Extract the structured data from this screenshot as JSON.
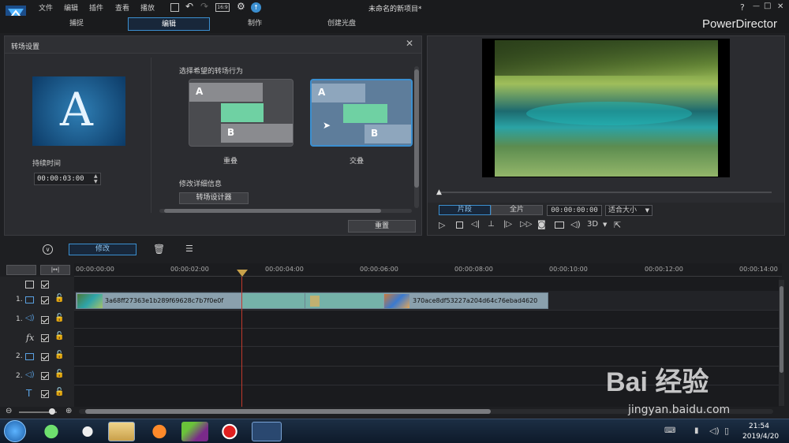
{
  "app": {
    "name": "PowerDirector",
    "project_title": "未命名的新项目*",
    "menus": [
      "文件",
      "编辑",
      "插件",
      "查看",
      "播放"
    ],
    "window_controls": [
      "?",
      "—",
      "□",
      "✕"
    ]
  },
  "mode_tabs": [
    {
      "label": "捕捉",
      "active": false
    },
    {
      "label": "编辑",
      "active": true
    },
    {
      "label": "制作",
      "active": false
    },
    {
      "label": "创建光盘",
      "active": false
    }
  ],
  "transition_panel": {
    "title": "转场设置",
    "thumb_letter": "A",
    "duration_label": "持续时间",
    "duration_value": "00:00:03:00",
    "behavior_label": "选择希望的转场行为",
    "options": [
      {
        "label": "重叠",
        "a": "A",
        "b": "B",
        "selected": false
      },
      {
        "label": "交叠",
        "a": "A",
        "b": "B",
        "selected": true
      }
    ],
    "detail_label": "修改详细信息",
    "designer_button": "转场设计器",
    "reset_button": "重置"
  },
  "player": {
    "modes": [
      "片段",
      "全片"
    ],
    "active_mode": "片段",
    "timecode": "00:00:00:00",
    "zoom": "适合大小",
    "three_d": "3D"
  },
  "timeline_toolbar": {
    "modify_button": "修改"
  },
  "ruler": [
    "00:00:00:00",
    "00:00:02:00",
    "00:00:04:00",
    "00:00:06:00",
    "00:00:08:00",
    "00:00:10:00",
    "00:00:12:00",
    "00:00:14:00"
  ],
  "tracks": [
    {
      "label": "1.",
      "type": "video"
    },
    {
      "label": "1.",
      "type": "audio"
    },
    {
      "label": "fx",
      "type": "fx"
    },
    {
      "label": "2.",
      "type": "video"
    },
    {
      "label": "2.",
      "type": "audio"
    },
    {
      "label": "T",
      "type": "title"
    }
  ],
  "clips": [
    {
      "name": "3a68ff27363e1b289f69628c7b7f0e0f"
    },
    {
      "name": "370ace8df53227a204d64c76ebad4620"
    }
  ],
  "taskbar": {
    "time": "21:54",
    "date": "2019/4/20"
  },
  "watermark": {
    "brand": "Bai 经验",
    "url": "jingyan.baidu.com"
  },
  "colors": {
    "accent": "#3b8fd0",
    "playhead": "#c0392b",
    "clip": "#8aa0ad",
    "transition": "#6fb7a8"
  }
}
